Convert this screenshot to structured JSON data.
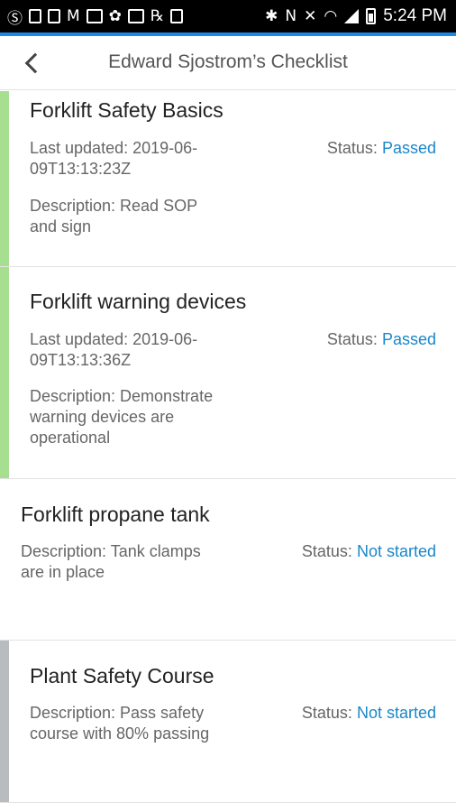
{
  "status_bar": {
    "time": "5:24 PM",
    "icons": [
      "skype-icon",
      "cast-icon",
      "alert-icon",
      "gmail-icon",
      "image-icon",
      "pinwheel-icon",
      "activity-icon",
      "prescription-icon",
      "usb-icon",
      "bluetooth-icon",
      "nfc-icon",
      "mute-icon",
      "wifi-icon",
      "signal-icon",
      "battery-icon"
    ]
  },
  "header": {
    "title": "Edward Sjostrom’s Checklist"
  },
  "colors": {
    "accent": "#1e88e5",
    "passed_bar": "#a6df8f",
    "pending_bar": "#b9bcbe",
    "status_value": "#1a87c9"
  },
  "status_label": "Status:",
  "items": [
    {
      "title": "Forklift Safety Basics",
      "updated_line1": "Last updated: 2019-06-",
      "updated_line2": "09T13:13:23Z",
      "desc_lines": [
        "Description: Read SOP",
        "and sign"
      ],
      "status": "Passed"
    },
    {
      "title": "Forklift warning devices",
      "updated_line1": "Last updated: 2019-06-",
      "updated_line2": "09T13:13:36Z",
      "desc_lines": [
        "Description: Demonstrate",
        "warning devices are",
        "operational"
      ],
      "status": "Passed"
    },
    {
      "title": "Forklift propane tank",
      "desc_lines": [
        "Description: Tank clamps",
        "are in place"
      ],
      "status": "Not started"
    },
    {
      "title": "Plant Safety Course",
      "desc_lines": [
        "Description: Pass safety",
        "course with 80% passing"
      ],
      "status": "Not started"
    }
  ]
}
